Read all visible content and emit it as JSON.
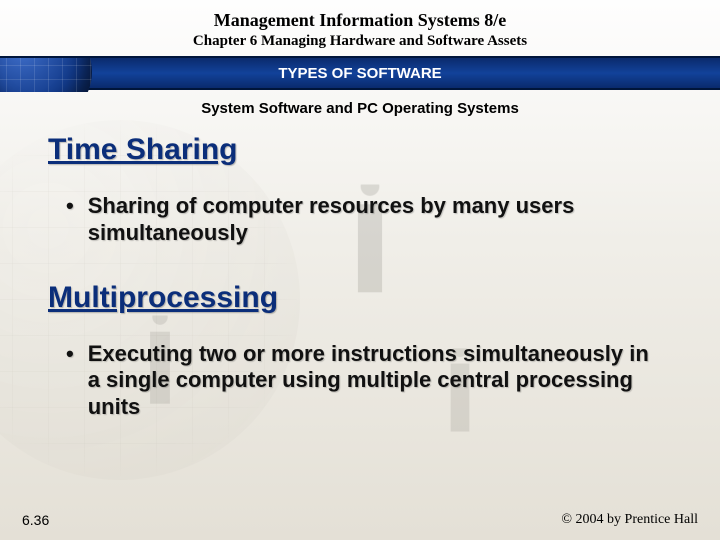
{
  "header": {
    "book_title": "Management Information Systems 8/e",
    "chapter": "Chapter 6 Managing Hardware and Software Assets"
  },
  "band": {
    "title": "TYPES OF SOFTWARE"
  },
  "subhead": "System Software and PC Operating Systems",
  "topics": [
    {
      "title": "Time Sharing",
      "bullet": "Sharing of computer resources by many users simultaneously"
    },
    {
      "title": "Multiprocessing",
      "bullet": "Executing two or more instructions simultaneously in a single computer using multiple central processing units"
    }
  ],
  "footer": {
    "slide_number": "6.36",
    "copyright": "© 2004 by Prentice Hall"
  }
}
